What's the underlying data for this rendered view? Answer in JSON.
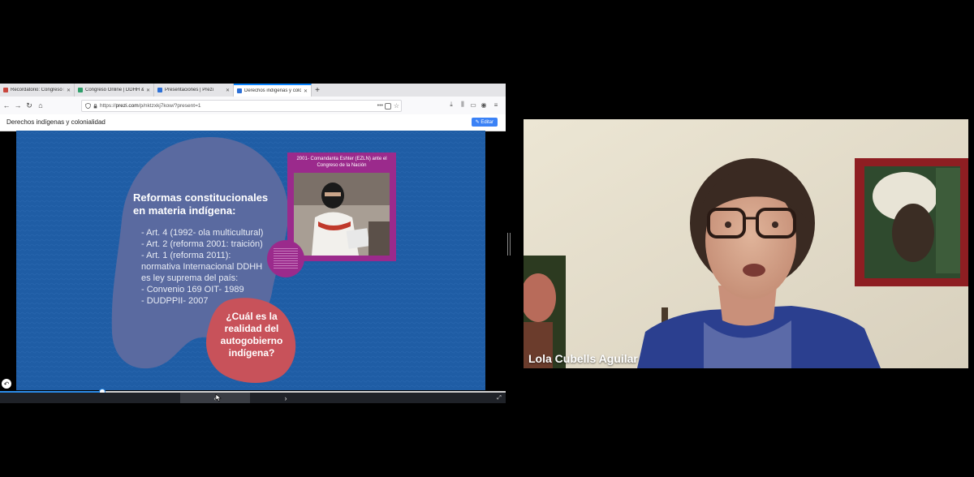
{
  "browser": {
    "tabs": [
      {
        "label": "Recordatorio: Congreso DDHH I",
        "active": false,
        "favicon_color": "#c9463d"
      },
      {
        "label": "Congreso Online | DDHH & Glob",
        "active": false,
        "favicon_color": "#2e9e6a"
      },
      {
        "label": "Presentaciones | Prezi",
        "active": false,
        "favicon_color": "#2b6fd6"
      },
      {
        "label": "Derechos indígenas y colonialid",
        "active": true,
        "favicon_color": "#2b6fd6"
      }
    ],
    "new_tab_symbol": "+",
    "url_prefix": "https://",
    "url_host": "prezi.com",
    "url_path": "/p/nktzxkj7kow/?present=1",
    "url_menu_symbol": "•••",
    "toolbar_icons": [
      "back-icon",
      "forward-icon",
      "reload-icon",
      "home-icon",
      "shield-icon",
      "lock-icon",
      "download-icon",
      "library-icon",
      "sidebar-icon",
      "account-icon",
      "menu-icon"
    ]
  },
  "prezi": {
    "title": "Derechos indígenas y colonialidad",
    "edit_label": "Editar",
    "slide": {
      "heading": "Reformas constitucionales en materia indígena:",
      "items": [
        "- Art. 4 (1992- ola multicultural)",
        "- Art. 2 (reforma 2001: traición)",
        "- Art. 1 (reforma 2011):",
        "normativa Internacional DDHH",
        "es ley suprema del país:",
        "- Convenio 169 OIT- 1989",
        "- DUDPPII- 2007"
      ],
      "photo_caption": "2001- Comandanta Eshter (EZLN) ante el Congreso de la Nación",
      "question": "¿Cuál es la realidad del autogobierno indígena?",
      "colors": {
        "background": "#1f5da5",
        "blob": "#5a6aa0",
        "photo_frame": "#9b2a8c",
        "question_blob": "#c8525a"
      }
    },
    "progress_fraction": 0.2,
    "controls": {
      "prev_symbol": "‹",
      "next_symbol": "›",
      "fullscreen_symbol": "⤢",
      "back_symbol": "↶"
    }
  },
  "webcam": {
    "participant_name": "Lola Cubells Aguilar"
  }
}
